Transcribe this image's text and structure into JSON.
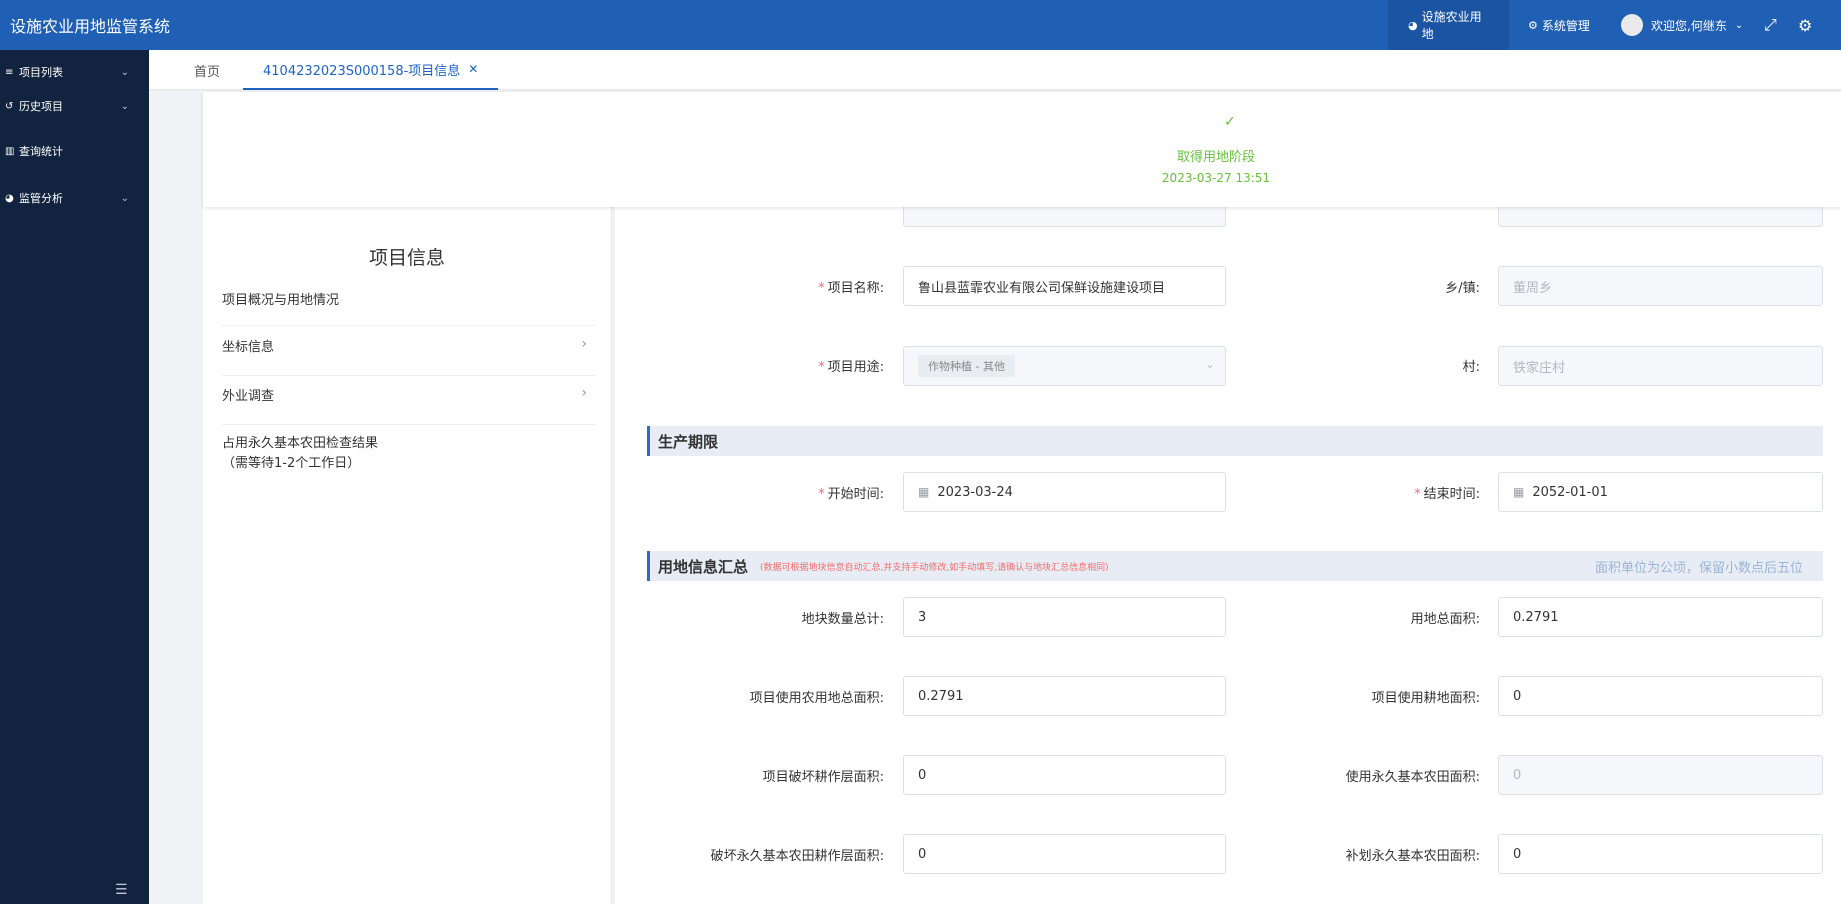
{
  "app_title": "设施农业用地监管系统",
  "topnav": {
    "farm_land": "设施农业用地",
    "system": "系统管理",
    "welcome": "欢迎您,何继东"
  },
  "sidebar": {
    "items": [
      {
        "label": "项目列表"
      },
      {
        "label": "历史项目"
      },
      {
        "label": "查询统计"
      },
      {
        "label": "监管分析"
      }
    ]
  },
  "tabs": {
    "home": "首页",
    "active": "4104232023S000158-项目信息"
  },
  "stage": {
    "label": "取得用地阶段",
    "time": "2023-03-27 13:51"
  },
  "left_panel": {
    "title": "项目信息",
    "items": [
      {
        "label": "项目概况与用地情况"
      },
      {
        "label": "坐标信息"
      },
      {
        "label": "外业调查"
      },
      {
        "label": "占用永久基本农田检查结果",
        "sub": "（需等待1-2个工作日）"
      }
    ]
  },
  "form": {
    "project_name": {
      "label": "项目名称:",
      "value": "鲁山县蓝霏农业有限公司保鲜设施建设项目"
    },
    "town": {
      "label": "乡/镇:",
      "value": "董周乡"
    },
    "purpose": {
      "label": "项目用途:",
      "value": "作物种植 - 其他"
    },
    "village": {
      "label": "村:",
      "value": "铁家庄村"
    },
    "section_period": "生产期限",
    "start": {
      "label": "开始时间:",
      "value": "2023-03-24"
    },
    "end": {
      "label": "结束时间:",
      "value": "2052-01-01"
    },
    "section_summary": "用地信息汇总",
    "summary_note": "(数据可根据地块信息自动汇总,并支持手动修改,如手动填写,请确认与地块汇总信息相同)",
    "summary_unit": "面积单位为公顷，保留小数点后五位",
    "parcel_count": {
      "label": "地块数量总计:",
      "value": "3"
    },
    "total_area": {
      "label": "用地总面积:",
      "value": "0.2791"
    },
    "ag_area": {
      "label": "项目使用农用地总面积:",
      "value": "0.2791"
    },
    "farm_area": {
      "label": "项目使用耕地面积:",
      "value": "0"
    },
    "damage_layer": {
      "label": "项目破坏耕作层面积:",
      "value": "0"
    },
    "perm_area": {
      "label": "使用永久基本农田面积:",
      "value": "0"
    },
    "perm_damage": {
      "label": "破坏永久基本农田耕作层面积:",
      "value": "0"
    },
    "perm_supp": {
      "label": "补划永久基本农田面积:",
      "value": "0"
    }
  }
}
